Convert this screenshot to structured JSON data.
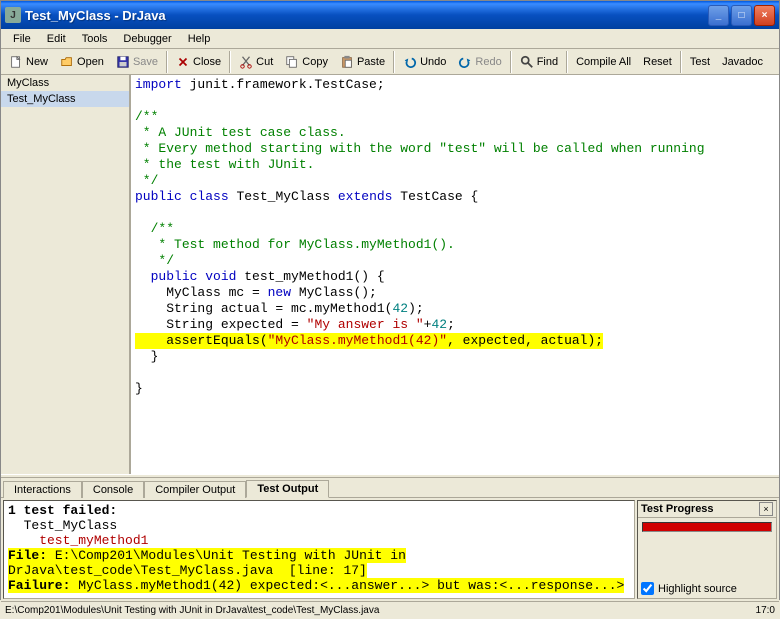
{
  "window": {
    "title": "Test_MyClass - DrJava",
    "icon_letter": "J"
  },
  "menubar": [
    "File",
    "Edit",
    "Tools",
    "Debugger",
    "Help"
  ],
  "toolbar": [
    {
      "name": "new-button",
      "label": "New",
      "icon": "new",
      "group": 0
    },
    {
      "name": "open-button",
      "label": "Open",
      "icon": "open",
      "group": 0
    },
    {
      "name": "save-button",
      "label": "Save",
      "icon": "save",
      "disabled": true,
      "group": 0
    },
    {
      "name": "close-button",
      "label": "Close",
      "icon": "close",
      "group": 1
    },
    {
      "name": "cut-button",
      "label": "Cut",
      "icon": "cut",
      "group": 2
    },
    {
      "name": "copy-button",
      "label": "Copy",
      "icon": "copy",
      "group": 2
    },
    {
      "name": "paste-button",
      "label": "Paste",
      "icon": "paste",
      "group": 2
    },
    {
      "name": "undo-button",
      "label": "Undo",
      "icon": "undo",
      "group": 3
    },
    {
      "name": "redo-button",
      "label": "Redo",
      "icon": "redo",
      "disabled": true,
      "group": 3
    },
    {
      "name": "find-button",
      "label": "Find",
      "icon": "find",
      "group": 4
    },
    {
      "name": "compile-all-button",
      "label": "Compile All",
      "group": 5
    },
    {
      "name": "reset-button",
      "label": "Reset",
      "group": 5
    },
    {
      "name": "test-button",
      "label": "Test",
      "group": 6
    },
    {
      "name": "javadoc-button",
      "label": "Javadoc",
      "group": 6
    }
  ],
  "files": [
    {
      "name": "MyClass",
      "selected": false
    },
    {
      "name": "Test_MyClass",
      "selected": true
    }
  ],
  "code": {
    "lines": [
      {
        "t": [
          {
            "s": "kw",
            "v": "import"
          },
          {
            "v": " junit.framework.TestCase;"
          }
        ]
      },
      {
        "t": [
          {
            "v": ""
          }
        ]
      },
      {
        "t": [
          {
            "s": "cm",
            "v": "/**"
          }
        ]
      },
      {
        "t": [
          {
            "s": "cm",
            "v": " * A JUnit test case class."
          }
        ]
      },
      {
        "t": [
          {
            "s": "cm",
            "v": " * Every method starting with the word \"test\" will be called when running"
          }
        ]
      },
      {
        "t": [
          {
            "s": "cm",
            "v": " * the test with JUnit."
          }
        ]
      },
      {
        "t": [
          {
            "s": "cm",
            "v": " */"
          }
        ]
      },
      {
        "t": [
          {
            "s": "kw",
            "v": "public"
          },
          {
            "v": " "
          },
          {
            "s": "kw",
            "v": "class"
          },
          {
            "v": " Test_MyClass "
          },
          {
            "s": "kw",
            "v": "extends"
          },
          {
            "v": " TestCase {"
          }
        ]
      },
      {
        "t": [
          {
            "v": "  "
          }
        ]
      },
      {
        "t": [
          {
            "v": "  "
          },
          {
            "s": "cm",
            "v": "/**"
          }
        ]
      },
      {
        "t": [
          {
            "v": "  "
          },
          {
            "s": "cm",
            "v": " * Test method for MyClass.myMethod1()."
          }
        ]
      },
      {
        "t": [
          {
            "v": "  "
          },
          {
            "s": "cm",
            "v": " */"
          }
        ]
      },
      {
        "t": [
          {
            "v": "  "
          },
          {
            "s": "kw",
            "v": "public"
          },
          {
            "v": " "
          },
          {
            "s": "kw",
            "v": "void"
          },
          {
            "v": " test_myMethod1() {"
          }
        ]
      },
      {
        "t": [
          {
            "v": "    MyClass mc = "
          },
          {
            "s": "kw",
            "v": "new"
          },
          {
            "v": " MyClass();"
          }
        ]
      },
      {
        "hl": false,
        "t": [
          {
            "v": "    String actual = mc.myMethod1("
          },
          {
            "s": "nm",
            "v": "42"
          },
          {
            "v": ");"
          }
        ]
      },
      {
        "hl": false,
        "t": [
          {
            "v": "    String expected = "
          },
          {
            "s": "st",
            "v": "\"My answer is \""
          },
          {
            "v": "+"
          },
          {
            "s": "nm",
            "v": "42"
          },
          {
            "v": ";"
          }
        ]
      },
      {
        "hl": true,
        "t": [
          {
            "v": "    assertEquals("
          },
          {
            "s": "st",
            "v": "\"MyClass.myMethod1(42)\""
          },
          {
            "v": ", expected, actual);"
          }
        ]
      },
      {
        "t": [
          {
            "v": "  }"
          }
        ]
      },
      {
        "t": [
          {
            "v": "  "
          }
        ]
      },
      {
        "t": [
          {
            "v": "}"
          }
        ]
      }
    ]
  },
  "bottom_tabs": [
    "Interactions",
    "Console",
    "Compiler Output",
    "Test Output"
  ],
  "bottom_active": 3,
  "test_output": {
    "header": "1 test failed:",
    "class_name": "  Test_MyClass",
    "method_name": "    test_myMethod1",
    "file_label": "File:",
    "file_line1": " E:\\Comp201\\Modules\\Unit Testing with JUnit in",
    "file_line2": "DrJava\\test_code\\Test_MyClass.java  [line: 17]",
    "failure_label": "Failure:",
    "failure_msg": " MyClass.myMethod1(42) expected:<...answer...> but was:<...response...>"
  },
  "test_progress": {
    "title": "Test Progress",
    "highlight_label": "Highlight source",
    "highlight_checked": true
  },
  "statusbar": {
    "path": "E:\\Comp201\\Modules\\Unit Testing with JUnit in DrJava\\test_code\\Test_MyClass.java",
    "pos": "17:0"
  }
}
